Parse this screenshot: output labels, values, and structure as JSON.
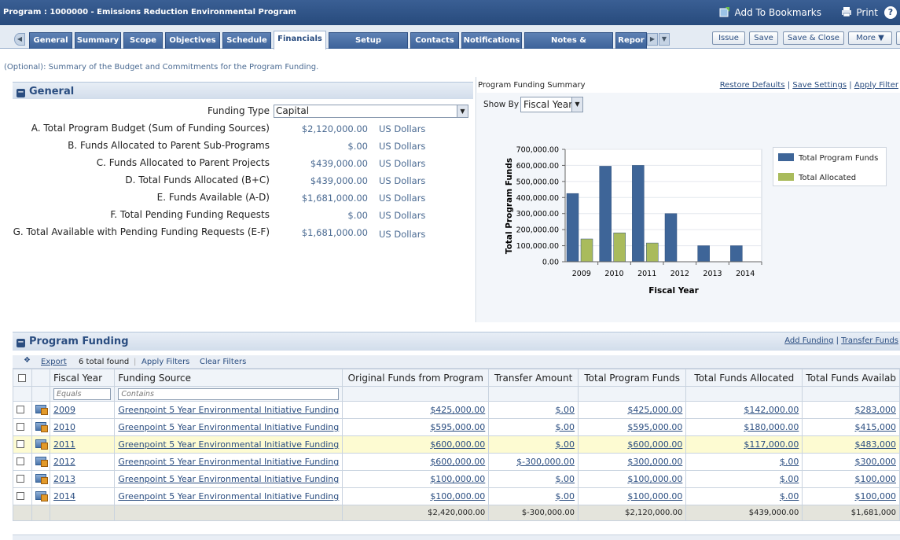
{
  "window": {
    "title": "Program : 1000000 - Emissions Reduction Environmental Program",
    "bookmark_label": "Add To Bookmarks",
    "print_label": "Print",
    "help_label": "?"
  },
  "tabs": [
    {
      "label": "General",
      "active": false
    },
    {
      "label": "Summary",
      "active": false
    },
    {
      "label": "Scope",
      "active": false
    },
    {
      "label": "Objectives",
      "active": false
    },
    {
      "label": "Schedule",
      "active": false
    },
    {
      "label": "Financials",
      "active": true
    },
    {
      "label": "Setup Parameters",
      "active": false
    },
    {
      "label": "Contacts",
      "active": false
    },
    {
      "label": "Notifications",
      "active": false
    },
    {
      "label": "Notes & Documents",
      "active": false
    },
    {
      "label": "Repor",
      "active": false
    }
  ],
  "actions": {
    "issue": "Issue",
    "save": "Save",
    "save_close": "Save & Close",
    "more": "More"
  },
  "subtitle": "(Optional): Summary of the Budget and Commitments for the Program Funding.",
  "general": {
    "title": "General",
    "funding_type_label": "Funding Type",
    "funding_type_value": "Capital",
    "rows": [
      {
        "label": "A. Total Program Budget (Sum of Funding Sources)",
        "value": "$2,120,000.00",
        "unit": "US Dollars"
      },
      {
        "label": "B. Funds Allocated to Parent Sub-Programs",
        "value": "$.00",
        "unit": "US Dollars"
      },
      {
        "label": "C. Funds Allocated to Parent Projects",
        "value": "$439,000.00",
        "unit": "US Dollars"
      },
      {
        "label": "D. Total Funds Allocated (B+C)",
        "value": "$439,000.00",
        "unit": "US Dollars"
      },
      {
        "label": "E. Funds Available (A-D)",
        "value": "$1,681,000.00",
        "unit": "US Dollars"
      },
      {
        "label": "F. Total Pending Funding Requests",
        "value": "$.00",
        "unit": "US Dollars"
      },
      {
        "label": "G. Total Available with Pending Funding Requests (E-F)",
        "value": "$1,681,000.00",
        "unit": "US Dollars"
      }
    ]
  },
  "summary_panel": {
    "title": "Program Funding Summary",
    "restore": "Restore Defaults",
    "save_settings": "Save Settings",
    "apply_filter": "Apply Filter",
    "sep": "|",
    "show_by_label": "Show By",
    "show_by_value": "Fiscal Year"
  },
  "chart_data": {
    "type": "bar",
    "categories": [
      "2009",
      "2010",
      "2011",
      "2012",
      "2013",
      "2014"
    ],
    "series": [
      {
        "name": "Total Program Funds",
        "color": "#3e6598",
        "values": [
          425000,
          595000,
          600000,
          300000,
          100000,
          100000
        ]
      },
      {
        "name": "Total Allocated",
        "color": "#a9bb5c",
        "values": [
          142000,
          180000,
          117000,
          0,
          0,
          0
        ]
      }
    ],
    "yticks": [
      "700,000.00",
      "600,000.00",
      "500,000.00",
      "400,000.00",
      "300,000.00",
      "200,000.00",
      "100,000.00",
      "0.00"
    ],
    "ylim": [
      0,
      700000
    ],
    "xlabel": "Fiscal Year",
    "ylabel": "Total Program Funds",
    "legend_position": "right"
  },
  "program_funding": {
    "title": "Program Funding",
    "add_funding": "Add Funding",
    "transfer_funds": "Transfer Funds",
    "sep": "|",
    "toolbar": {
      "export": "Export",
      "found": "6 total found",
      "apply_filters": "Apply Filters",
      "clear_filters": "Clear Filters"
    },
    "columns": [
      "Fiscal Year",
      "Funding Source",
      "Original Funds from Program",
      "Transfer Amount",
      "Total Program Funds",
      "Total Funds Allocated",
      "Total Funds Availab"
    ],
    "filter_placeholders": {
      "fiscal_year": "Equals",
      "funding_source": "Contains"
    },
    "rows": [
      {
        "year": "2009",
        "source": "Greenpoint 5 Year Environmental Initiative Funding",
        "original": "$425,000.00",
        "transfer": "$.00",
        "total": "$425,000.00",
        "allocated": "$142,000.00",
        "available": "$283,000"
      },
      {
        "year": "2010",
        "source": "Greenpoint 5 Year Environmental Initiative Funding",
        "original": "$595,000.00",
        "transfer": "$.00",
        "total": "$595,000.00",
        "allocated": "$180,000.00",
        "available": "$415,000"
      },
      {
        "year": "2011",
        "source": "Greenpoint 5 Year Environmental Initiative Funding",
        "original": "$600,000.00",
        "transfer": "$.00",
        "total": "$600,000.00",
        "allocated": "$117,000.00",
        "available": "$483,000"
      },
      {
        "year": "2012",
        "source": "Greenpoint 5 Year Environmental Initiative Funding",
        "original": "$600,000.00",
        "transfer": "$-300,000.00",
        "total": "$300,000.00",
        "allocated": "$.00",
        "available": "$300,000"
      },
      {
        "year": "2013",
        "source": "Greenpoint 5 Year Environmental Initiative Funding",
        "original": "$100,000.00",
        "transfer": "$.00",
        "total": "$100,000.00",
        "allocated": "$.00",
        "available": "$100,000"
      },
      {
        "year": "2014",
        "source": "Greenpoint 5 Year Environmental Initiative Funding",
        "original": "$100,000.00",
        "transfer": "$.00",
        "total": "$100,000.00",
        "allocated": "$.00",
        "available": "$100,000"
      }
    ],
    "totals": {
      "original": "$2,420,000.00",
      "transfer": "$-300,000.00",
      "total": "$2,120,000.00",
      "allocated": "$439,000.00",
      "available": "$1,681,000"
    }
  }
}
